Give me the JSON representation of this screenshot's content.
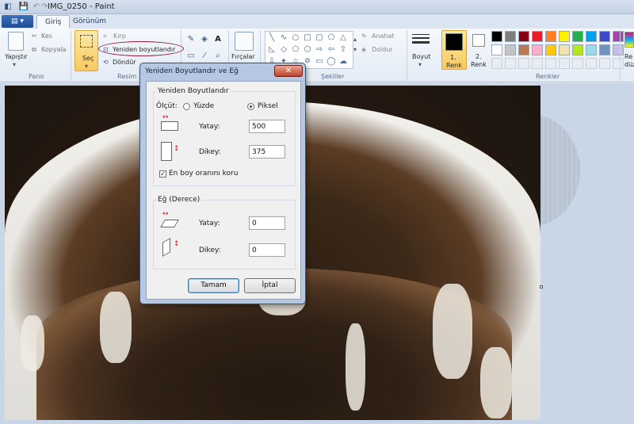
{
  "window": {
    "title": "IMG_0250 - Paint"
  },
  "ribbon": {
    "app_menu": "▤ ▾",
    "tabs": [
      {
        "label": "Giriş"
      },
      {
        "label": "Görünüm"
      }
    ],
    "clipboard": {
      "paste": "Yapıştır",
      "cut": "Kes",
      "copy": "Kopyala",
      "group": "Pano"
    },
    "image": {
      "select": "Seç",
      "crop": "Kırp",
      "resize": "Yeniden boyutlandır",
      "rotate": "Döndür",
      "group": "Resim"
    },
    "tools": {
      "brushes": "Fırçalar"
    },
    "shapes": {
      "outline": "Anahat",
      "fill": "Doldur",
      "group": "Şekiller"
    },
    "size": {
      "label": "Boyut"
    },
    "colors": {
      "color1_label_line1": "1.",
      "color1_label_line2": "Renk",
      "color2_label_line1": "2.",
      "color2_label_line2": "Renk",
      "group": "Renkler",
      "edit_label_partial": "Re",
      "edit_label_partial2": "düz",
      "palette_row1": [
        "#000000",
        "#7f7f7f",
        "#880015",
        "#ed1c24",
        "#ff7f27",
        "#fff200",
        "#22b14c",
        "#00a2e8",
        "#3f48cc",
        "#a349a4"
      ],
      "palette_row2": [
        "#ffffff",
        "#c3c3c3",
        "#b97a57",
        "#ffaec9",
        "#ffc90e",
        "#efe4b0",
        "#b5e61d",
        "#99d9ea",
        "#7092be",
        "#c8bfe7"
      ]
    }
  },
  "dialog": {
    "title": "Yeniden Boyutlandır ve Eğ",
    "close": "✕",
    "resize": {
      "legend": "Yeniden Boyutlandır",
      "unit_label": "Ölçüt:",
      "percent_label": "Yüzde",
      "pixel_label": "Piksel",
      "selected_unit": "Piksel",
      "horizontal_label": "Yatay:",
      "horizontal_value": "500",
      "vertical_label": "Dikey:",
      "vertical_value": "375",
      "aspect_label": "En boy oranını koru",
      "aspect_checked": true
    },
    "skew": {
      "legend": "Eğ (Derece)",
      "horizontal_label": "Yatay:",
      "horizontal_value": "0",
      "vertical_label": "Dikey:",
      "vertical_value": "0"
    },
    "ok": "Tamam",
    "cancel": "İptal"
  }
}
